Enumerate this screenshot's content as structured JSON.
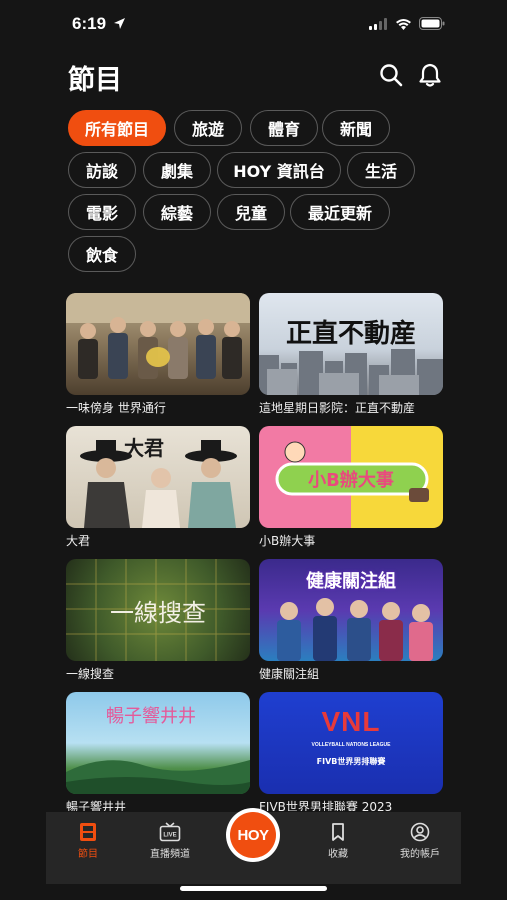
{
  "status_bar": {
    "time": "6:19"
  },
  "header": {
    "title": "節目"
  },
  "filters": [
    {
      "label": "所有節目",
      "active": true
    },
    {
      "label": "旅遊",
      "active": false
    },
    {
      "label": "體育",
      "active": false
    },
    {
      "label": "新聞",
      "active": false
    },
    {
      "label": "訪談",
      "active": false
    },
    {
      "label": "劇集",
      "active": false
    },
    {
      "label": "HOY 資訊台",
      "active": false
    },
    {
      "label": "生活",
      "active": false
    },
    {
      "label": "電影",
      "active": false
    },
    {
      "label": "綜藝",
      "active": false
    },
    {
      "label": "兒童",
      "active": false
    },
    {
      "label": "最近更新",
      "active": false
    },
    {
      "label": "飲食",
      "active": false
    }
  ],
  "programs": [
    {
      "title": "一味傍身 世界通行"
    },
    {
      "title": "這地星期日影院：正直不動産",
      "thumb_text": "正直不動産"
    },
    {
      "title": "大君",
      "thumb_text": "大君"
    },
    {
      "title": "小B辦大事",
      "thumb_text": "小B辦大事"
    },
    {
      "title": "一線搜查",
      "thumb_text": "一線搜查"
    },
    {
      "title": "健康關注組",
      "thumb_text": "健康關注組"
    },
    {
      "title": "暢子響井井",
      "thumb_text": "暢子響井井"
    },
    {
      "title": "FIVB世界男排聯賽 2023",
      "thumb_text": "VNL",
      "thumb_sub1": "VOLLEYBALL NATIONS LEAGUE",
      "thumb_sub2": "FIVB世界男排聯賽"
    }
  ],
  "tabbar": {
    "items": [
      {
        "label": "節目",
        "icon": "film-icon",
        "active": true
      },
      {
        "label": "直播頻道",
        "icon": "live-tv-icon",
        "active": false
      },
      {
        "label": "收藏",
        "icon": "bookmark-icon",
        "active": false
      },
      {
        "label": "我的帳戶",
        "icon": "account-icon",
        "active": false
      }
    ],
    "center_logo": "HOY"
  },
  "colors": {
    "accent": "#f04e10",
    "background": "#151515",
    "tabbar": "#262626"
  }
}
